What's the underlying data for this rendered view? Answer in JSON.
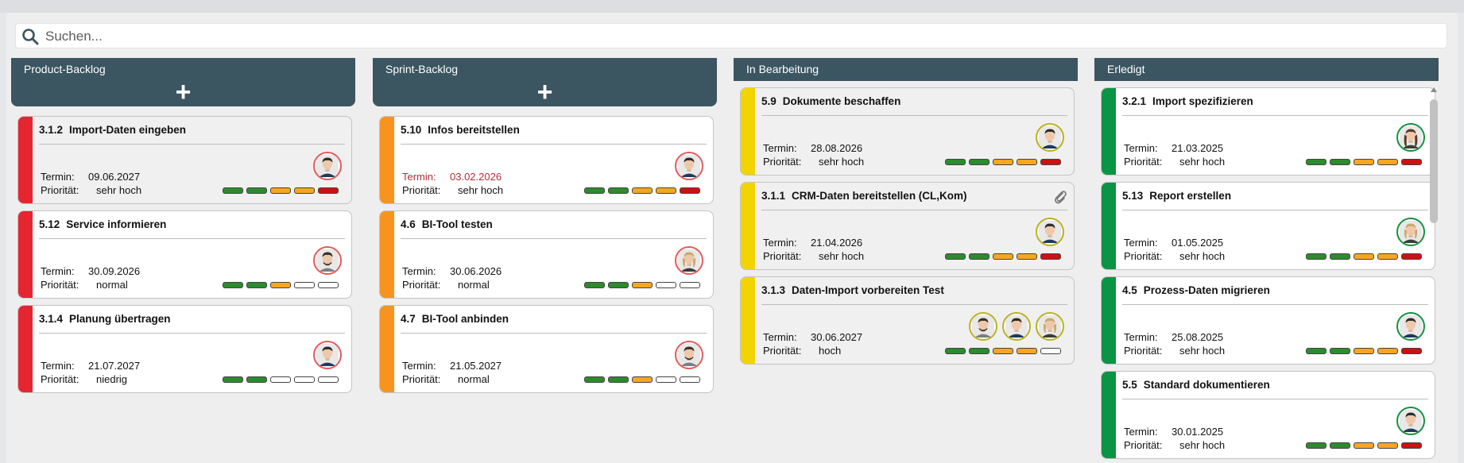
{
  "search": {
    "placeholder": "Suchen..."
  },
  "labels": {
    "termin": "Termin:",
    "prioritaet": "Priorität:"
  },
  "colors": {
    "header": "#3b5561",
    "red": "#e52530",
    "orange": "#f7941d",
    "yellow": "#f1d400",
    "green": "#0a9444",
    "seg_green": "#2c8b2c",
    "seg_orange": "#f5a623",
    "seg_red": "#cc1111"
  },
  "columns": [
    {
      "title": "Product-Backlog",
      "add_icon": "plus-icon",
      "cards": [
        {
          "number": "3.1.2",
          "title": "Import-Daten eingeben",
          "termin": "09.06.2027",
          "prioritaet": "sehr hoch",
          "termin_overdue": false,
          "segments": [
            "g",
            "g",
            "o",
            "o",
            "r"
          ],
          "avatars": [
            {
              "name": "avatar-man-dark-hair"
            }
          ],
          "attachment": false
        },
        {
          "number": "5.12",
          "title": "Service informieren",
          "termin": "30.09.2026",
          "prioritaet": "normal",
          "termin_overdue": false,
          "segments": [
            "g",
            "g",
            "o",
            "e",
            "e"
          ],
          "avatars": [
            {
              "name": "avatar-man-beard"
            }
          ],
          "attachment": false
        },
        {
          "number": "3.1.4",
          "title": "Planung übertragen",
          "termin": "21.07.2027",
          "prioritaet": "niedrig",
          "termin_overdue": false,
          "segments": [
            "g",
            "g",
            "e",
            "e",
            "e"
          ],
          "avatars": [
            {
              "name": "avatar-man-dark-hair"
            }
          ],
          "attachment": false
        }
      ]
    },
    {
      "title": "Sprint-Backlog",
      "add_icon": "plus-icon",
      "cards": [
        {
          "number": "5.10",
          "title": "Infos bereitstellen",
          "termin": "03.02.2026",
          "prioritaet": "sehr hoch",
          "termin_overdue": true,
          "segments": [
            "g",
            "g",
            "o",
            "o",
            "r"
          ],
          "avatars": [
            {
              "name": "avatar-man-dark-hair"
            }
          ],
          "attachment": false
        },
        {
          "number": "4.6",
          "title": "BI-Tool testen",
          "termin": "30.06.2026",
          "prioritaet": "normal",
          "termin_overdue": false,
          "segments": [
            "g",
            "g",
            "o",
            "e",
            "e"
          ],
          "avatars": [
            {
              "name": "avatar-woman-blonde"
            }
          ],
          "attachment": false
        },
        {
          "number": "4.7",
          "title": "BI-Tool anbinden",
          "termin": "21.05.2027",
          "prioritaet": "normal",
          "termin_overdue": false,
          "segments": [
            "g",
            "g",
            "o",
            "e",
            "e"
          ],
          "avatars": [
            {
              "name": "avatar-man-beard"
            }
          ],
          "attachment": false
        }
      ]
    },
    {
      "title": "In Bearbeitung",
      "cards": [
        {
          "number": "5.9",
          "title": "Dokumente beschaffen",
          "termin": "28.08.2026",
          "prioritaet": "sehr hoch",
          "termin_overdue": false,
          "segments": [
            "g",
            "g",
            "o",
            "o",
            "r"
          ],
          "avatars": [
            {
              "name": "avatar-man-dark-hair"
            }
          ],
          "attachment": false
        },
        {
          "number": "3.1.1",
          "title": "CRM-Daten bereitstellen (CL,Kom)",
          "termin": "21.04.2026",
          "prioritaet": "sehr hoch",
          "termin_overdue": false,
          "segments": [
            "g",
            "g",
            "o",
            "o",
            "r"
          ],
          "avatars": [
            {
              "name": "avatar-man-dark-hair"
            }
          ],
          "attachment": true
        },
        {
          "number": "3.1.3",
          "title": "Daten-Import vorbereiten Test",
          "termin": "30.06.2027",
          "prioritaet": "hoch",
          "termin_overdue": false,
          "segments": [
            "g",
            "g",
            "o",
            "o",
            "e"
          ],
          "avatars": [
            {
              "name": "avatar-man-beard"
            },
            {
              "name": "avatar-man-dark-hair"
            },
            {
              "name": "avatar-woman-blonde"
            }
          ],
          "attachment": false
        }
      ]
    },
    {
      "title": "Erledigt",
      "cards": [
        {
          "number": "3.2.1",
          "title": "Import spezifizieren",
          "termin": "21.03.2025",
          "prioritaet": "sehr hoch",
          "termin_overdue": false,
          "segments": [
            "g",
            "g",
            "o",
            "o",
            "r"
          ],
          "avatars": [
            {
              "name": "avatar-woman-long-hair"
            }
          ],
          "attachment": false
        },
        {
          "number": "5.13",
          "title": "Report erstellen",
          "termin": "01.05.2025",
          "prioritaet": "sehr hoch",
          "termin_overdue": false,
          "segments": [
            "g",
            "g",
            "o",
            "o",
            "r"
          ],
          "avatars": [
            {
              "name": "avatar-woman-blonde"
            }
          ],
          "attachment": false
        },
        {
          "number": "4.5",
          "title": "Prozess-Daten migrieren",
          "termin": "25.08.2025",
          "prioritaet": "sehr hoch",
          "termin_overdue": false,
          "segments": [
            "g",
            "g",
            "o",
            "o",
            "r"
          ],
          "avatars": [
            {
              "name": "avatar-man-dark-hair"
            }
          ],
          "attachment": false
        },
        {
          "number": "5.5",
          "title": "Standard dokumentieren",
          "termin": "30.01.2025",
          "prioritaet": "sehr hoch",
          "termin_overdue": false,
          "segments": [
            "g",
            "g",
            "o",
            "o",
            "r"
          ],
          "avatars": [
            {
              "name": "avatar-man-dark-hair"
            }
          ],
          "attachment": false
        }
      ]
    }
  ]
}
